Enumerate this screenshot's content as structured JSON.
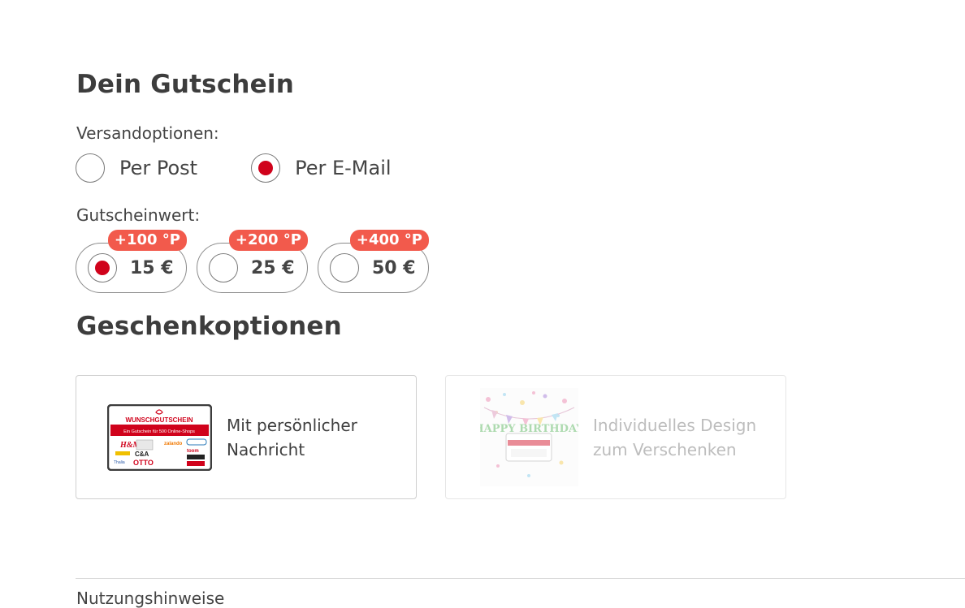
{
  "title": "Dein Gutschein",
  "shipping": {
    "label": "Versandoptionen:",
    "options": [
      {
        "label": "Per Post",
        "selected": false
      },
      {
        "label": "Per E-Mail",
        "selected": true
      }
    ]
  },
  "value": {
    "label": "Gutscheinwert:",
    "options": [
      {
        "amount": "15 €",
        "bonus": "+100 °P",
        "selected": true
      },
      {
        "amount": "25 €",
        "bonus": "+200 °P",
        "selected": false
      },
      {
        "amount": "50 €",
        "bonus": "+400 °P",
        "selected": false
      }
    ]
  },
  "gift": {
    "title": "Geschenkoptionen",
    "options": [
      {
        "label_line1": "Mit persönlicher",
        "label_line2": "Nachricht",
        "enabled": true
      },
      {
        "label_line1": "Individuelles Design",
        "label_line2": "zum Verschenken",
        "enabled": false
      }
    ],
    "card_image": {
      "brand": "WUNSCHGUTSCHEIN",
      "tagline": "Ein Gutschein für 500 Online-Shops",
      "logos": [
        "H&M",
        "zalando",
        "C&A",
        "OTTO",
        "toom",
        "Thalia"
      ]
    },
    "design_image": {
      "banner": "HAPPY BIRTHDAY"
    }
  },
  "footer": {
    "link": "Nutzungshinweise"
  },
  "colors": {
    "accent": "#d0021b",
    "badge": "#f25a4c",
    "text": "#3f3f3f"
  }
}
